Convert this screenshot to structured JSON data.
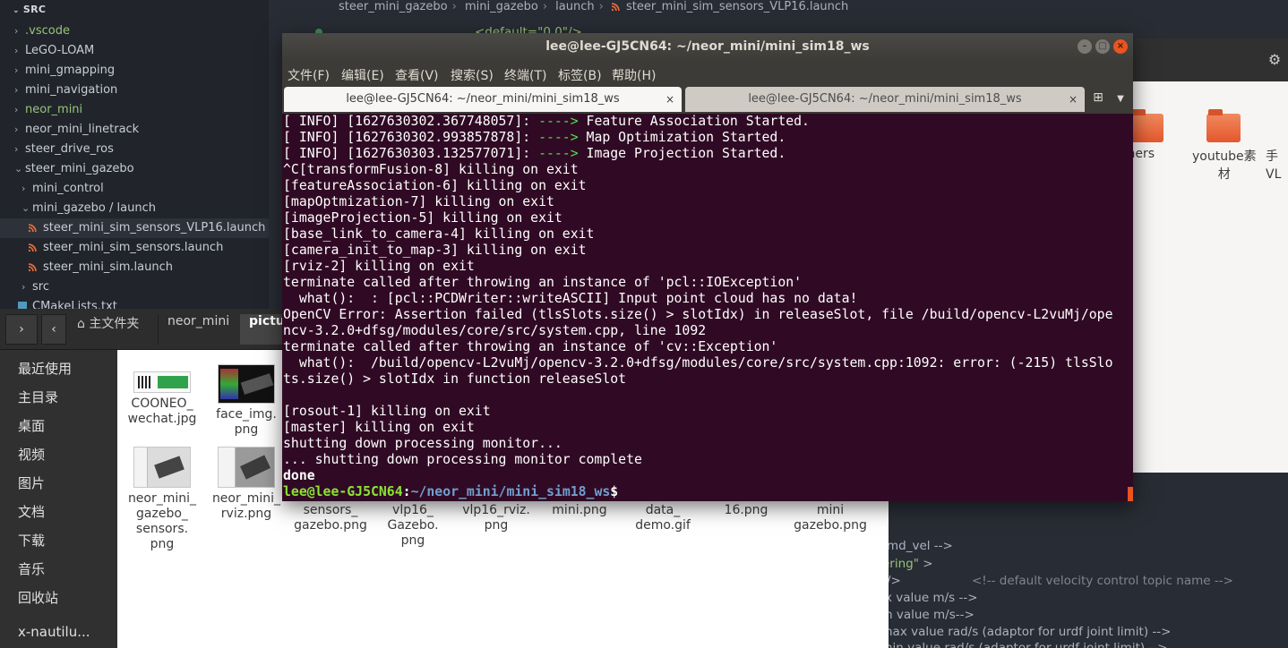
{
  "vscode": {
    "section_title": "SRC",
    "tree": [
      {
        "label": ".vscode",
        "chevron": "›",
        "green": true
      },
      {
        "label": "LeGO-LOAM",
        "chevron": "›",
        "green": false
      },
      {
        "label": "mini_gmapping",
        "chevron": "›",
        "green": false
      },
      {
        "label": "mini_navigation",
        "chevron": "›",
        "green": false
      },
      {
        "label": "neor_mini",
        "chevron": "›",
        "green": true
      },
      {
        "label": "neor_mini_linetrack",
        "chevron": "›",
        "green": false
      },
      {
        "label": "steer_drive_ros",
        "chevron": "›",
        "green": false
      },
      {
        "label": "steer_mini_gazebo",
        "chevron": "⌄",
        "green": false
      },
      {
        "label": "mini_control",
        "chevron": "›",
        "green": false
      },
      {
        "label": "mini_gazebo / launch",
        "chevron": "⌄",
        "green": false
      },
      {
        "label": "steer_mini_sim_sensors_VLP16.launch",
        "chevron": "",
        "green": false
      },
      {
        "label": "steer_mini_sim_sensors.launch",
        "chevron": "",
        "green": false
      },
      {
        "label": "steer_mini_sim.launch",
        "chevron": "",
        "green": false
      },
      {
        "label": "src",
        "chevron": "›",
        "green": false
      },
      {
        "label": "CMakeLists.txt",
        "chevron": "",
        "green": false
      }
    ],
    "breadcrumb": [
      "steer_mini_gazebo",
      "mini_gazebo",
      "launch",
      "steer_mini_sim_sensors_VLP16.launch"
    ],
    "code_fragments": {
      "top": "<default=\"0.0\"/>",
      "l1": "md_vel -->",
      "l2_str": "ering\"",
      "l2_rest": " >",
      "l3": "/>",
      "l3_cmt": "<!-- default velocity control topic name -->",
      "l4": "x value   m/s -->",
      "l5": "n value   m/s-->",
      "l6": "nax value  rad/s (adaptor for urdf joint limit) -->",
      "l7": "nin value  rad/s (adaptor for urdf joint limit) -->"
    }
  },
  "nautilus": {
    "nav_back": "‹",
    "crumbs": [
      "主文件夹",
      "neor_mini",
      "pictu"
    ],
    "places": [
      "最近使用",
      "主目录",
      "桌面",
      "视频",
      "图片",
      "文档",
      "下载",
      "音乐",
      "回收站",
      "x-nautilu..."
    ],
    "files_row1": [
      {
        "name": "COONEO_\nwechat.jpg",
        "thumb": "wechat"
      },
      {
        "name": "face_img.\npng",
        "thumb": "face"
      }
    ],
    "files_row2": [
      {
        "name": "neor_mini_\ngazebo_\nsensors.\npng",
        "thumb": "rviz"
      },
      {
        "name": "neor_mini_\nrviz.png",
        "thumb": "gz"
      },
      {
        "name": "sensors_\ngazebo.png",
        "thumb": ""
      },
      {
        "name": "vlp16_\nGazebo.\npng",
        "thumb": ""
      },
      {
        "name": "vlp16_rviz.\npng",
        "thumb": ""
      },
      {
        "name": "mini.png",
        "thumb": ""
      },
      {
        "name": "data_\ndemo.gif",
        "thumb": ""
      },
      {
        "name": "16.png",
        "thumb": ""
      },
      {
        "name": "mini\ngazebo.png",
        "thumb": ""
      }
    ]
  },
  "bg_files": {
    "gear": "⚙",
    "items": [
      "thers",
      "youtube素\n材",
      "手\nVL"
    ]
  },
  "terminal": {
    "title": "lee@lee-GJ5CN64: ~/neor_mini/mini_sim18_ws",
    "window_buttons": [
      "–",
      "□",
      "×"
    ],
    "menu": [
      "文件(F)",
      "编辑(E)",
      "查看(V)",
      "搜索(S)",
      "终端(T)",
      "标签(B)",
      "帮助(H)"
    ],
    "tabs": [
      {
        "label": "lee@lee-GJ5CN64: ~/neor_mini/mini_sim18_ws",
        "close": "×"
      },
      {
        "label": "lee@lee-GJ5CN64: ~/neor_mini/mini_sim18_ws",
        "close": "×"
      }
    ],
    "new_tab_icon": "⊞",
    "more_icon": "▼",
    "info_lines": [
      {
        "prefix": "[ INFO] [1627630302.367748057]: ",
        "arrow": "---->",
        "msg": " Feature Association Started."
      },
      {
        "prefix": "[ INFO] [1627630302.993857878]: ",
        "arrow": "---->",
        "msg": " Map Optimization Started."
      },
      {
        "prefix": "[ INFO] [1627630303.132577071]: ",
        "arrow": "---->",
        "msg": " Image Projection Started."
      }
    ],
    "lines": [
      "^C[transformFusion-8] killing on exit",
      "[featureAssociation-6] killing on exit",
      "[mapOptmization-7] killing on exit",
      "[imageProjection-5] killing on exit",
      "[base_link_to_camera-4] killing on exit",
      "[camera_init_to_map-3] killing on exit",
      "[rviz-2] killing on exit",
      "terminate called after throwing an instance of 'pcl::IOException'",
      "  what():  : [pcl::PCDWriter::writeASCII] Input point cloud has no data!",
      "OpenCV Error: Assertion failed (tlsSlots.size() > slotIdx) in releaseSlot, file /build/opencv-L2vuMj/ope",
      "ncv-3.2.0+dfsg/modules/core/src/system.cpp, line 1092",
      "terminate called after throwing an instance of 'cv::Exception'",
      "  what():  /build/opencv-L2vuMj/opencv-3.2.0+dfsg/modules/core/src/system.cpp:1092: error: (-215) tlsSlo",
      "ts.size() > slotIdx in function releaseSlot",
      "",
      "[rosout-1] killing on exit",
      "[master] killing on exit",
      "shutting down processing monitor...",
      "... shutting down processing monitor complete"
    ],
    "done": "done",
    "prompt_user": "lee@lee-GJ5CN64",
    "prompt_sep": ":",
    "prompt_path": "~/neor_mini/mini_sim18_ws",
    "prompt_end": "$"
  },
  "colors": {
    "terminal_bg": "#300a24",
    "arrow_green": "#4fdf4f",
    "prompt_green": "#8ae234",
    "prompt_blue": "#729fcf",
    "ubuntu_orange": "#e95420"
  }
}
